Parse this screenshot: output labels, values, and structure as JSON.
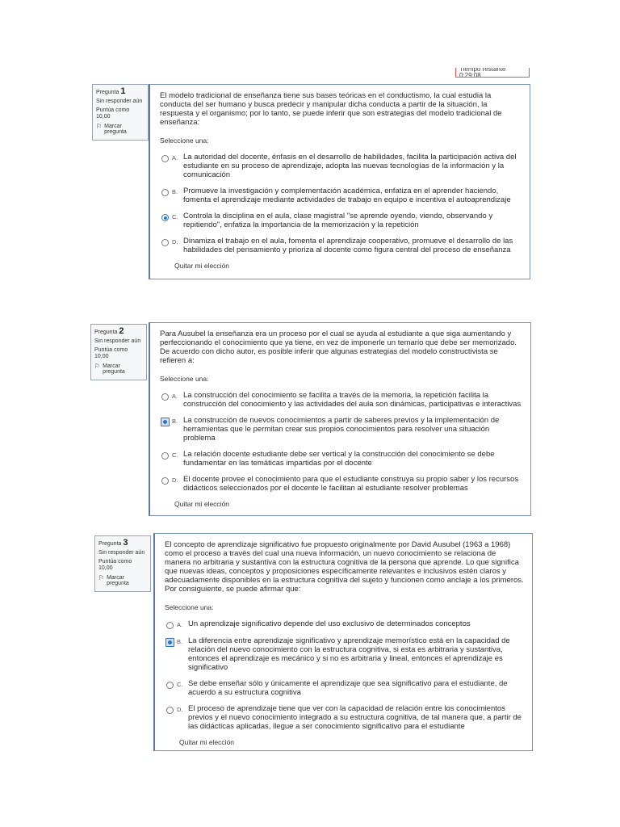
{
  "timer": "Tiempo restante 0:29:08",
  "questions": [
    {
      "label": "Pregunta",
      "number": "1",
      "status": "Sin responder aún",
      "score": "Puntúa como 10,00",
      "flag": "Marcar pregunta",
      "text": "El modelo tradicional de enseñanza tiene sus bases teóricas en el conductismo, la cual estudia la conducta del ser humano y busca predecir y manipular dicha conducta a partir de la situación, la respuesta y el organismo; por lo tanto, se puede inferir que son estrategias del modelo tradicional de enseñanza:",
      "prompt": "Seleccione una:",
      "options": [
        {
          "letter": "A.",
          "text": "La autoridad del docente, énfasis en el desarrollo de habilidades, facilita la participación activa del estudiante en su proceso de aprendizaje, adopta las nuevas tecnologías de la información y la comunicación"
        },
        {
          "letter": "B.",
          "text": "Promueve la investigación y complementación académica, enfatiza en el aprender haciendo, fomenta el aprendizaje mediante actividades de trabajo en equipo e incentiva el autoaprendizaje"
        },
        {
          "letter": "C.",
          "text": "Controla la disciplina en el aula, clase magistral \"se aprende oyendo, viendo, observando y repitiendo\", enfatiza la importancia de la memorización y la repetición"
        },
        {
          "letter": "D.",
          "text": "Dinamiza el trabajo en el aula, fomenta el aprendizaje cooperativo, promueve el desarrollo de las habilidades del pensamiento y prioriza al docente como figura central del proceso de enseñanza"
        }
      ],
      "selected": "C",
      "clear": "Quitar mi elección"
    },
    {
      "label": "Pregunta",
      "number": "2",
      "status": "Sin responder aún",
      "score": "Puntúa como 10,00",
      "flag": "Marcar pregunta",
      "text": "Para Ausubel la enseñanza era un proceso por el cual se ayuda al estudiante a que siga aumentando y perfeccionando el conocimiento que ya tiene, en vez de imponerle un temario que debe ser memorizado. De acuerdo con dicho autor, es posible inferir que algunas estrategias del modelo constructivista se refieren a:",
      "prompt": "Seleccione una:",
      "options": [
        {
          "letter": "A.",
          "text": "La construcción del conocimiento se facilita a través de la memoria, la repetición facilita la construcción del conocimiento y las actividades del aula son dinámicas, participativas e interactivas"
        },
        {
          "letter": "B.",
          "text": "La construcción de nuevos conocimientos a partir de saberes previos y la implementación de herramientas que le permitan crear sus propios conocimientos para resolver una situación problema"
        },
        {
          "letter": "C.",
          "text": "La relación docente estudiante debe ser vertical y la construcción del conocimiento se debe fundamentar en las temáticas impartidas por el docente"
        },
        {
          "letter": "D.",
          "text": "El docente provee el conocimiento para que el estudiante construya su propio saber y los recursos didácticos seleccionados por el docente le facilitan  al estudiante resolver problemas"
        }
      ],
      "selected": "B",
      "clear": "Quitar mi elección"
    },
    {
      "label": "Pregunta",
      "number": "3",
      "status": "Sin responder aún",
      "score": "Puntúa como 10,00",
      "flag": "Marcar pregunta",
      "text": "El concepto de aprendizaje significativo fue propuesto originalmente por David Ausubel (1963 a 1968) como el proceso a través del cual una nueva información, un nuevo conocimiento se relaciona de manera no arbitraria y sustantiva con la estructura cognitiva de la persona que aprende. Lo que significa que nuevas ideas, conceptos y proposiciones específicamente relevantes e inclusivos estén claros y adecuadamente disponibles en la estructura cognitiva del sujeto y funcionen como anclaje a los primeros. Por consiguiente, se puede afirmar que:",
      "prompt": "Seleccione una:",
      "options": [
        {
          "letter": "A.",
          "text": "Un aprendizaje significativo depende del uso exclusivo de determinados conceptos"
        },
        {
          "letter": "B.",
          "text": "La diferencia entre aprendizaje significativo y aprendizaje memorístico está en la capacidad de relación del nuevo conocimiento con la estructura cognitiva, si esta es arbitraria y sustantiva, entonces el aprendizaje es mecánico y si no es arbitraria y lineal, entonces el aprendizaje es significativo"
        },
        {
          "letter": "C.",
          "text": "Se debe enseñar sólo y únicamente el aprendizaje que sea significativo para el estudiante, de acuerdo a su estructura cognitiva"
        },
        {
          "letter": "D.",
          "text": "El proceso de aprendizaje tiene que ver con la capacidad de relación entre los conocimientos previos y el nuevo conocimiento integrado a su estructura cognitiva, de tal manera que, a partir de las didácticas aplicadas, llegue a ser conocimiento significativo para el estudiante"
        }
      ],
      "selected": "B",
      "clear": "Quitar mi elección"
    }
  ]
}
